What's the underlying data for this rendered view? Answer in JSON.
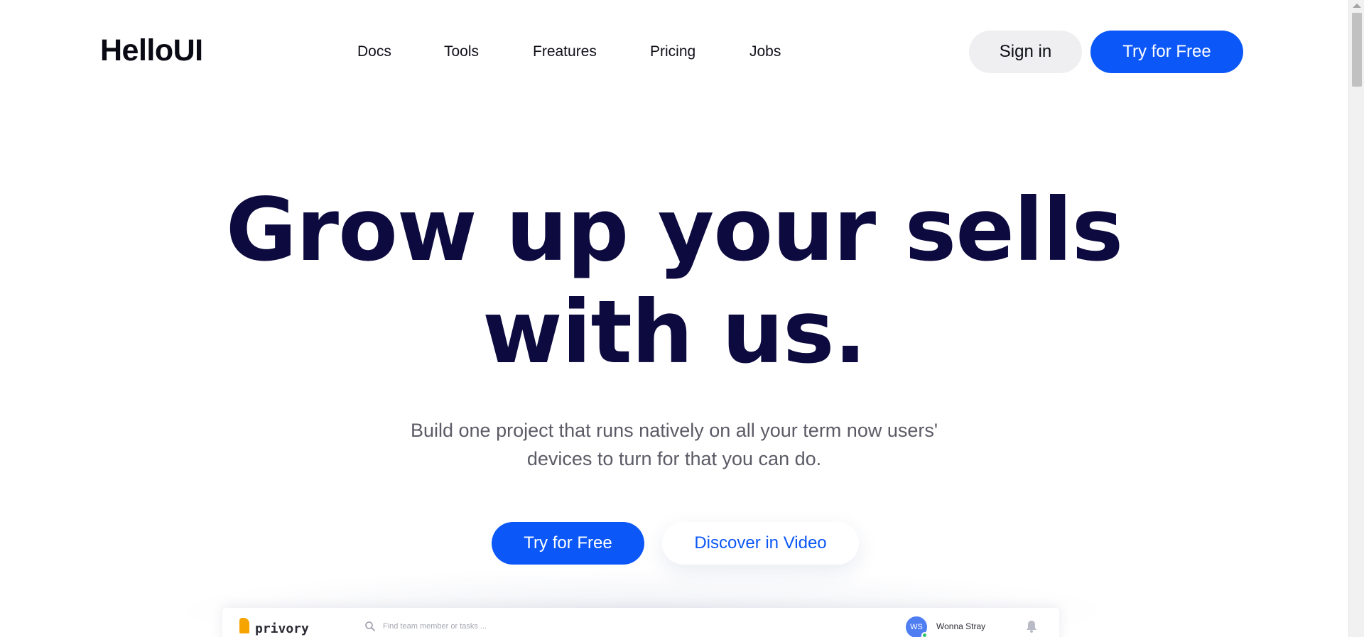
{
  "brand": {
    "logo_text": "HelloUI"
  },
  "nav": {
    "items": [
      {
        "label": "Docs"
      },
      {
        "label": "Tools"
      },
      {
        "label": "Freatures"
      },
      {
        "label": "Pricing"
      },
      {
        "label": "Jobs"
      }
    ]
  },
  "header_actions": {
    "signin_label": "Sign in",
    "try_label": "Try for Free"
  },
  "hero": {
    "title_line1": "Grow up your sells",
    "title_line2": "with us.",
    "subtitle_line1": "Build one project that runs natively on all your term now users'",
    "subtitle_line2": "devices to turn for that you can do.",
    "primary_cta": "Try for Free",
    "secondary_cta": "Discover in Video"
  },
  "preview": {
    "app_name": "privory",
    "search_placeholder": "Find team member or tasks ...",
    "avatar_initials": "WS",
    "user_name": "Wonna Stray",
    "icons": [
      "search-icon",
      "bell-icon"
    ]
  },
  "colors": {
    "primary": "#0b57f7",
    "heading": "#0c0a3e",
    "body_text": "#5b5b66",
    "signin_bg": "#efeff1",
    "preview_logo": "#f5a400"
  }
}
